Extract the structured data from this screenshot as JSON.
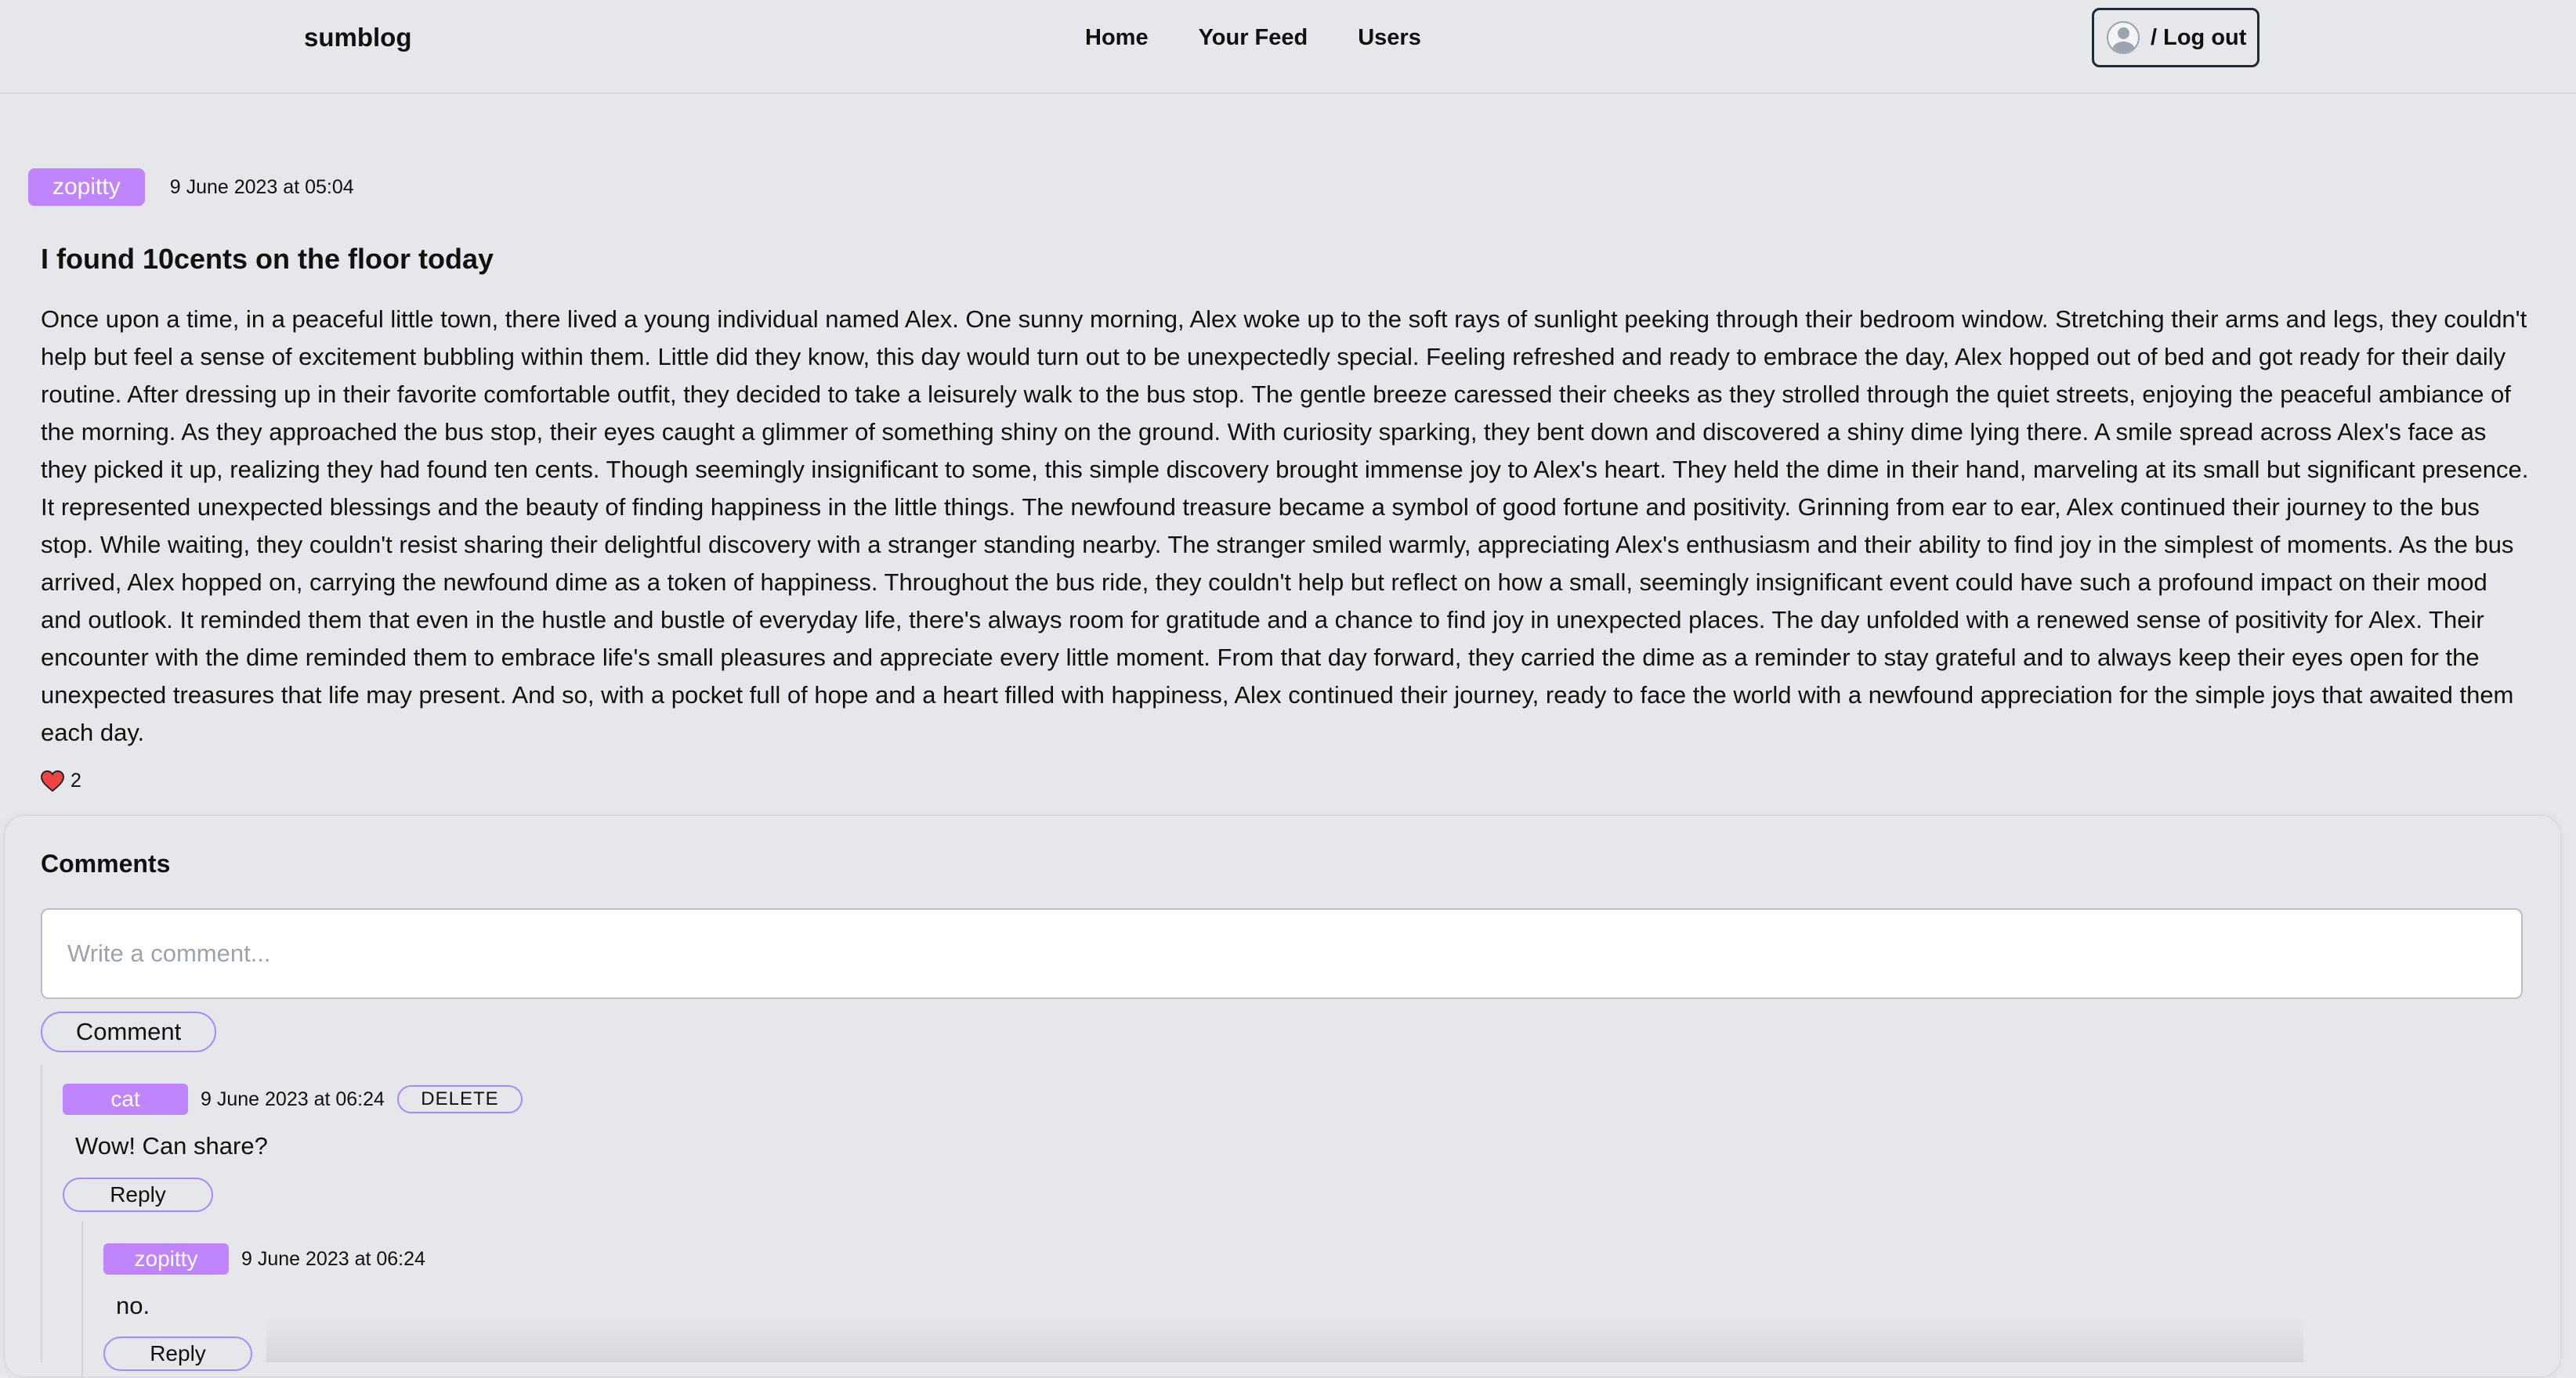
{
  "header": {
    "brand": "sumblog",
    "nav": [
      "Home",
      "Your Feed",
      "Users"
    ],
    "logout_label": "/ Log out",
    "avatar_icon": "user-avatar-icon"
  },
  "post": {
    "author": "zopitty",
    "date": "9 June 2023 at 05:04",
    "title": "I found 10cents on the floor today",
    "body": "Once upon a time, in a peaceful little town, there lived a young individual named Alex. One sunny morning, Alex woke up to the soft rays of sunlight peeking through their bedroom window. Stretching their arms and legs, they couldn't help but feel a sense of excitement bubbling within them. Little did they know, this day would turn out to be unexpectedly special. Feeling refreshed and ready to embrace the day, Alex hopped out of bed and got ready for their daily routine. After dressing up in their favorite comfortable outfit, they decided to take a leisurely walk to the bus stop. The gentle breeze caressed their cheeks as they strolled through the quiet streets, enjoying the peaceful ambiance of the morning. As they approached the bus stop, their eyes caught a glimmer of something shiny on the ground. With curiosity sparking, they bent down and discovered a shiny dime lying there. A smile spread across Alex's face as they picked it up, realizing they had found ten cents. Though seemingly insignificant to some, this simple discovery brought immense joy to Alex's heart. They held the dime in their hand, marveling at its small but significant presence. It represented unexpected blessings and the beauty of finding happiness in the little things. The newfound treasure became a symbol of good fortune and positivity. Grinning from ear to ear, Alex continued their journey to the bus stop. While waiting, they couldn't resist sharing their delightful discovery with a stranger standing nearby. The stranger smiled warmly, appreciating Alex's enthusiasm and their ability to find joy in the simplest of moments. As the bus arrived, Alex hopped on, carrying the newfound dime as a token of happiness. Throughout the bus ride, they couldn't help but reflect on how a small, seemingly insignificant event could have such a profound impact on their mood and outlook. It reminded them that even in the hustle and bustle of everyday life, there's always room for gratitude and a chance to find joy in unexpected places. The day unfolded with a renewed sense of positivity for Alex. Their encounter with the dime reminded them to embrace life's small pleasures and appreciate every little moment. From that day forward, they carried the dime as a reminder to stay grateful and to always keep their eyes open for the unexpected treasures that life may present. And so, with a pocket full of hope and a heart filled with happiness, Alex continued their journey, ready to face the world with a newfound appreciation for the simple joys that awaited them each day.",
    "likes": "2",
    "like_icon": "heart-icon"
  },
  "comments": {
    "heading": "Comments",
    "input_placeholder": "Write a comment...",
    "submit_label": "Comment",
    "items": [
      {
        "author": "cat",
        "date": "9 June 2023 at 06:24",
        "delete_label": "DELETE",
        "text": "Wow! Can share?",
        "reply_label": "Reply",
        "replies": [
          {
            "author": "zopitty",
            "date": "9 June 2023 at 06:24",
            "text": "no.",
            "reply_label": "Reply"
          }
        ]
      }
    ]
  },
  "colors": {
    "background": "#e5e7eb",
    "badge": "#c084fc",
    "button_border": "#a78bfa",
    "heart": "#ef4444"
  }
}
